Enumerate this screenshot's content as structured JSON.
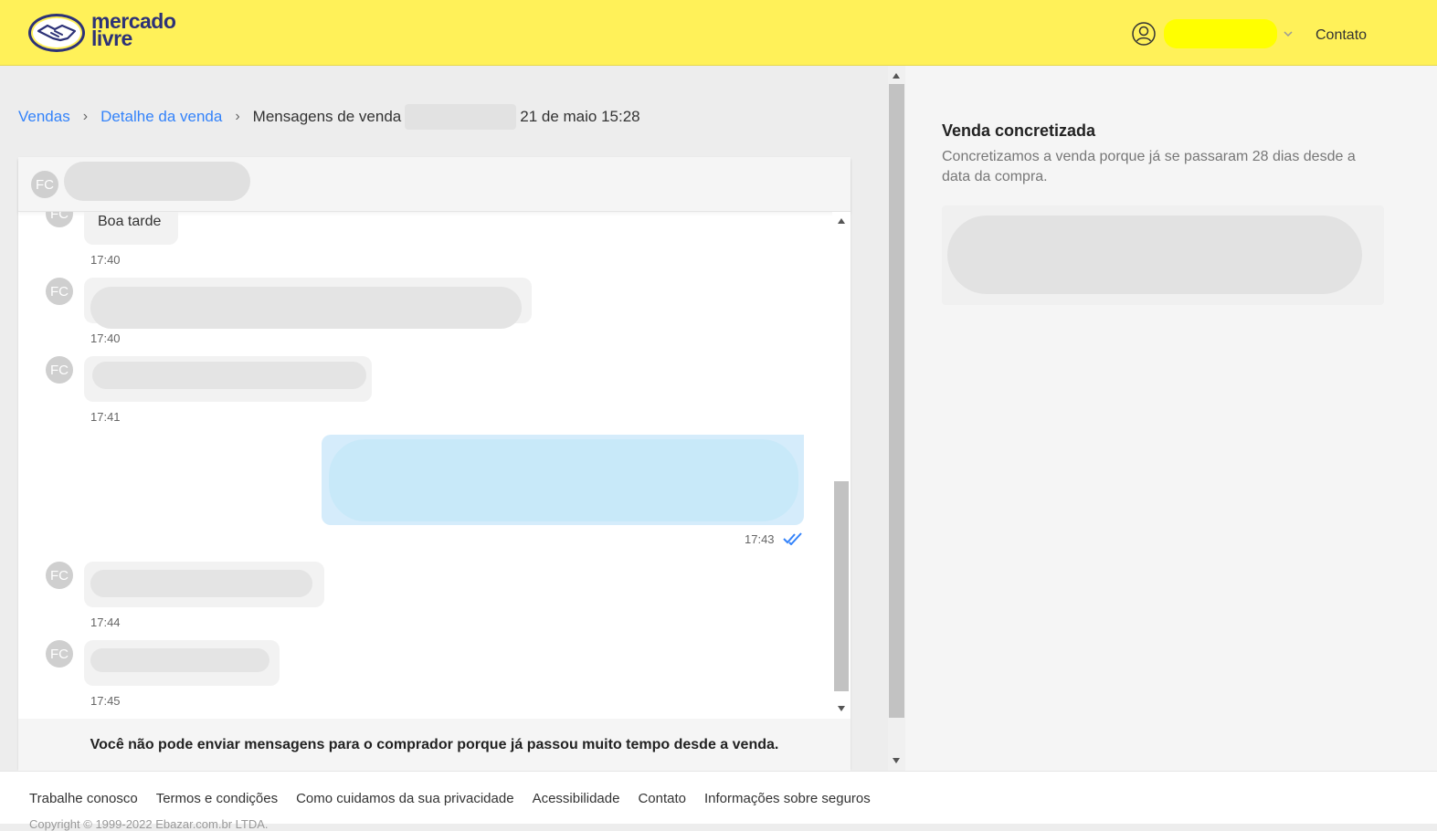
{
  "header": {
    "logo_line1": "mercado",
    "logo_line2": "livre",
    "contact_label": "Contato"
  },
  "breadcrumb": {
    "items": [
      "Vendas",
      "Detalhe da venda"
    ],
    "current": "Mensagens de venda",
    "date": "21 de maio 15:28"
  },
  "chat": {
    "avatar_initials": "FC",
    "messages": [
      {
        "direction": "in",
        "text": "Boa tarde",
        "time": "17:40"
      },
      {
        "direction": "in",
        "text": "",
        "time": "17:40"
      },
      {
        "direction": "in",
        "text": "",
        "time": "17:41"
      },
      {
        "direction": "out",
        "text": "",
        "time": "17:43"
      },
      {
        "direction": "in",
        "text": "",
        "time": "17:44"
      },
      {
        "direction": "in",
        "text": "",
        "time": "17:45"
      }
    ],
    "footer_notice": "Você não pode enviar mensagens para o comprador porque já passou muito tempo desde a venda."
  },
  "sale_status": {
    "title": "Venda concretizada",
    "description": "Concretizamos a venda porque já se passaram 28 dias desde a data da compra."
  },
  "footer": {
    "links": [
      "Trabalhe conosco",
      "Termos e condições",
      "Como cuidamos da sua privacidade",
      "Acessibilidade",
      "Contato",
      "Informações sobre seguros"
    ],
    "copyright": "Copyright © 1999-2022 Ebazar.com.br LTDA."
  },
  "colors": {
    "brand_yellow": "#fff159",
    "link_blue": "#3483fa",
    "outgoing_bubble": "#d5ecfb"
  }
}
